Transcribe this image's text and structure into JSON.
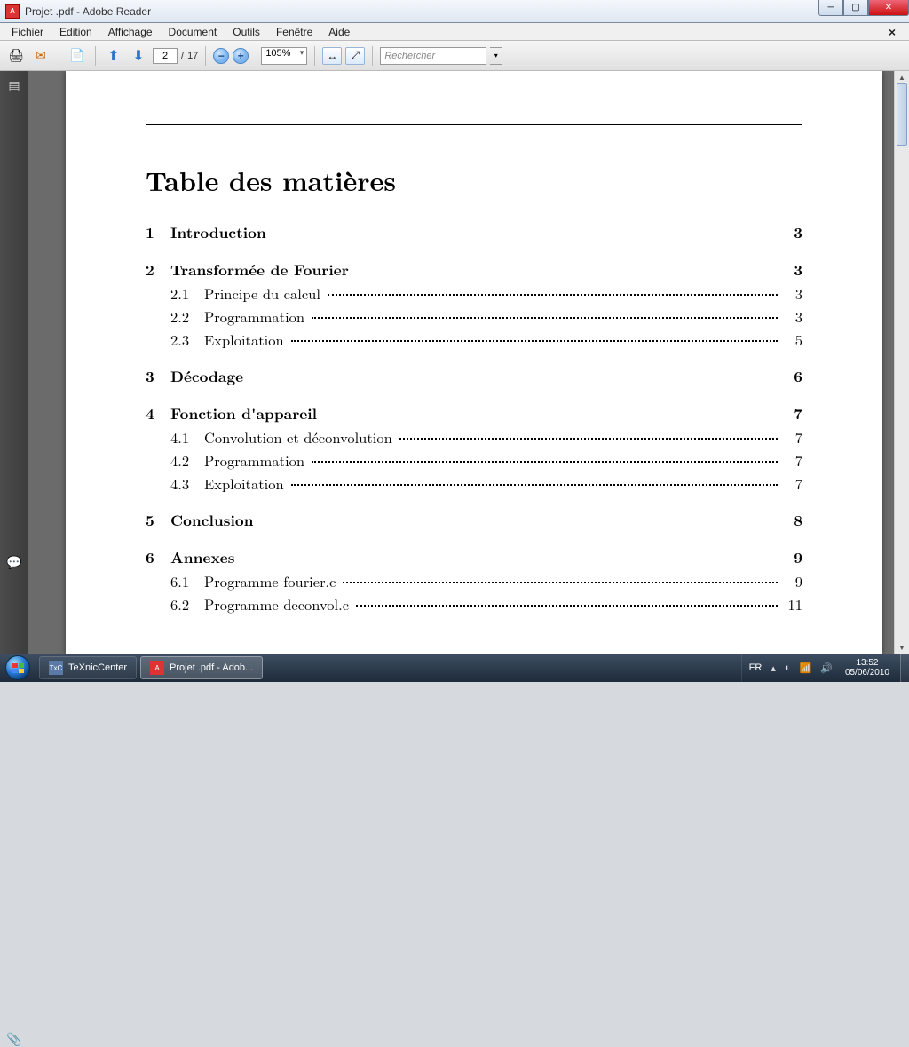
{
  "window": {
    "title": "Projet .pdf - Adobe Reader"
  },
  "menu": {
    "items": [
      "Fichier",
      "Edition",
      "Affichage",
      "Document",
      "Outils",
      "Fenêtre",
      "Aide"
    ]
  },
  "toolbar": {
    "page_current": "2",
    "page_sep": "/",
    "page_total": "17",
    "zoom": "105%",
    "search_placeholder": "Rechercher"
  },
  "document": {
    "toc_title": "Table des matières",
    "sections": [
      {
        "num": "1",
        "label": "Introduction",
        "page": "3",
        "subs": []
      },
      {
        "num": "2",
        "label": "Transformée de Fourier",
        "page": "3",
        "subs": [
          {
            "num": "2.1",
            "label": "Principe du calcul",
            "page": "3"
          },
          {
            "num": "2.2",
            "label": "Programmation",
            "page": "3"
          },
          {
            "num": "2.3",
            "label": "Exploitation",
            "page": "5"
          }
        ]
      },
      {
        "num": "3",
        "label": "Décodage",
        "page": "6",
        "subs": []
      },
      {
        "num": "4",
        "label": "Fonction d'appareil",
        "page": "7",
        "subs": [
          {
            "num": "4.1",
            "label": "Convolution et déconvolution",
            "page": "7"
          },
          {
            "num": "4.2",
            "label": "Programmation",
            "page": "7"
          },
          {
            "num": "4.3",
            "label": "Exploitation",
            "page": "7"
          }
        ]
      },
      {
        "num": "5",
        "label": "Conclusion",
        "page": "8",
        "subs": []
      },
      {
        "num": "6",
        "label": "Annexes",
        "page": "9",
        "subs": [
          {
            "num": "6.1",
            "label": "Programme fourier.c",
            "page": "9"
          },
          {
            "num": "6.2",
            "label": "Programme deconvol.c",
            "page": "11"
          }
        ]
      }
    ]
  },
  "taskbar": {
    "tasks": [
      {
        "label": "TeXnicCenter",
        "icon": "TxC"
      },
      {
        "label": "Projet .pdf - Adob...",
        "icon": "PDF"
      }
    ],
    "lang": "FR",
    "time": "13:52",
    "date": "05/06/2010"
  }
}
